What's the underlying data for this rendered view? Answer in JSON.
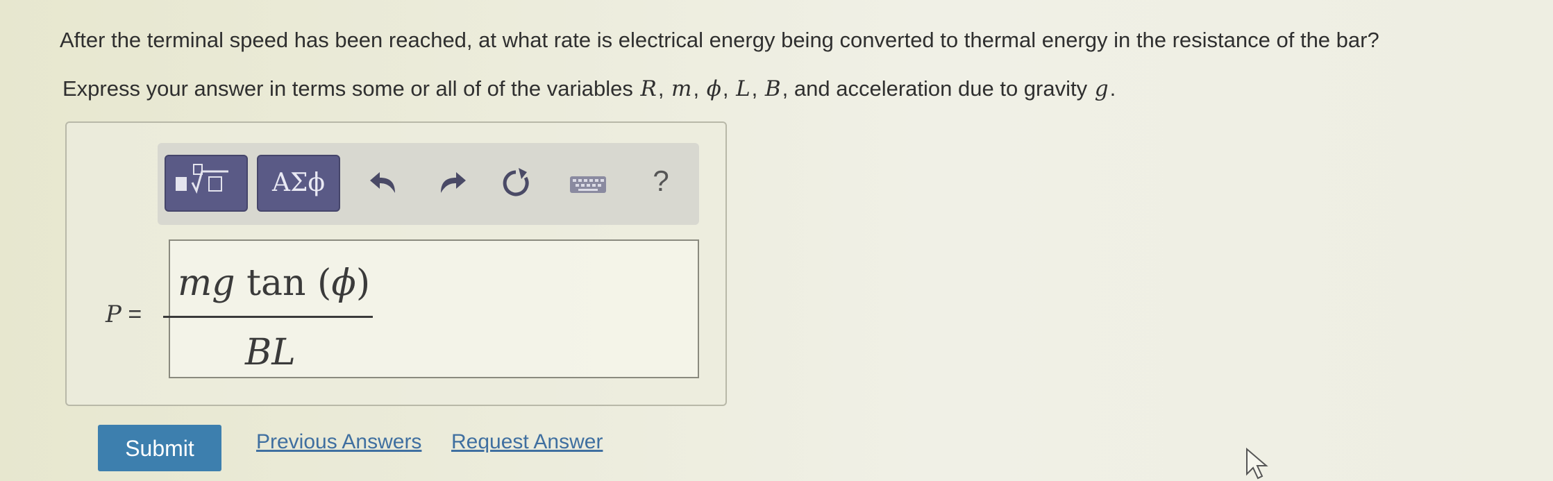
{
  "question": {
    "text": "After the terminal speed has been reached, at what rate is electrical energy being converted to thermal energy in the resistance of the bar?"
  },
  "instruction": {
    "prefix": "Express your answer in terms some or all of of the variables",
    "var_R": "R",
    "var_m": "m",
    "var_phi": "ϕ",
    "var_L": "L",
    "var_B": "B",
    "and_text": ", and acceleration due to gravity",
    "var_g": "g",
    "period": "."
  },
  "toolbar": {
    "greek_label": "ΑΣϕ",
    "help_label": "?",
    "icons": [
      "templates-icon",
      "undo-icon",
      "redo-icon",
      "reset-icon",
      "keyboard-icon",
      "help-icon"
    ]
  },
  "answer": {
    "label_var": "P",
    "label_eq": " =",
    "numerator_vars": "mg",
    "numerator_func": "tan",
    "numerator_open": " (",
    "numerator_arg": "ϕ",
    "numerator_close": ")",
    "denominator": "BL"
  },
  "actions": {
    "submit_label": "Submit",
    "previous_answers_label": "Previous Answers",
    "request_answer_label": "Request Answer"
  },
  "colors": {
    "submit_bg": "#3d7fae",
    "toolbar_button_bg": "#5a5a86",
    "link": "#3f6fa0"
  }
}
